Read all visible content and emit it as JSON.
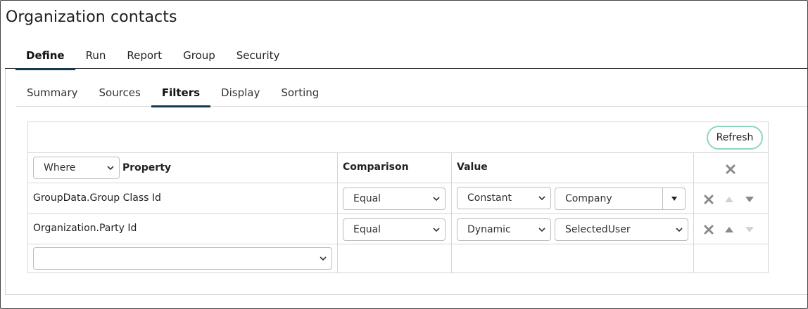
{
  "page": {
    "title": "Organization contacts"
  },
  "main_tabs": [
    {
      "label": "Define",
      "active": true
    },
    {
      "label": "Run"
    },
    {
      "label": "Report"
    },
    {
      "label": "Group"
    },
    {
      "label": "Security"
    }
  ],
  "sub_tabs": [
    {
      "label": "Summary"
    },
    {
      "label": "Sources"
    },
    {
      "label": "Filters",
      "active": true
    },
    {
      "label": "Display"
    },
    {
      "label": "Sorting"
    }
  ],
  "toolbar": {
    "refresh_label": "Refresh"
  },
  "filter_table": {
    "header": {
      "where_select": "Where",
      "property": "Property",
      "comparison": "Comparison",
      "value": "Value"
    },
    "rows": [
      {
        "property": "GroupData.Group Class Id",
        "comparison": "Equal",
        "value_type": "Constant",
        "value": "Company",
        "up_enabled": false,
        "down_enabled": true
      },
      {
        "property": "Organization.Party Id",
        "comparison": "Equal",
        "value_type": "Dynamic",
        "value": "SelectedUser",
        "up_enabled": true,
        "down_enabled": false
      }
    ],
    "new_property": ""
  },
  "icons": {
    "remove": "close-x-icon",
    "move_up": "triangle-up-icon",
    "move_down": "triangle-down-icon",
    "dropdown": "chevron-down-icon"
  },
  "colors": {
    "tab_underline": "#143a52",
    "refresh_border": "#8fd4c1",
    "icon_enabled": "#8a8a8a",
    "icon_disabled": "#d2d2d2"
  }
}
